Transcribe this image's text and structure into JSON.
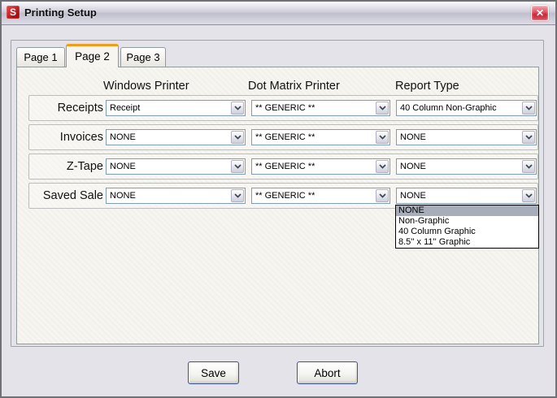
{
  "window": {
    "title": "Printing Setup",
    "icon_letter": "S",
    "close_glyph": "✕"
  },
  "tabs": [
    {
      "label": "Page 1",
      "active": false
    },
    {
      "label": "Page 2",
      "active": true
    },
    {
      "label": "Page 3",
      "active": false
    }
  ],
  "columns": [
    "Windows Printer",
    "Dot Matrix Printer",
    "Report Type"
  ],
  "rows": [
    {
      "label": "Receipts",
      "windows_printer": "Receipt",
      "dot_matrix_printer": "** GENERIC **",
      "report_type": "40 Column Non-Graphic"
    },
    {
      "label": "Invoices",
      "windows_printer": "NONE",
      "dot_matrix_printer": "** GENERIC **",
      "report_type": "NONE"
    },
    {
      "label": "Z-Tape",
      "windows_printer": "NONE",
      "dot_matrix_printer": "** GENERIC **",
      "report_type": "NONE"
    },
    {
      "label": "Saved Sale",
      "windows_printer": "NONE",
      "dot_matrix_printer": "** GENERIC **",
      "report_type": "NONE"
    }
  ],
  "open_dropdown": {
    "for_row": "Saved Sale",
    "for_column": "Report Type",
    "highlighted": "NONE",
    "options": [
      "NONE",
      "Non-Graphic",
      "40 Column Graphic",
      "8.5'' x 11'' Graphic"
    ]
  },
  "buttons": {
    "save": "Save",
    "abort": "Abort"
  },
  "colors": {
    "active_tab_accent": "#F09B1C",
    "close_button_red": "#CC2738",
    "app_icon_red": "#A80A0E",
    "list_highlight": "#A7ADB9",
    "combo_border": "#7F9DB9"
  }
}
